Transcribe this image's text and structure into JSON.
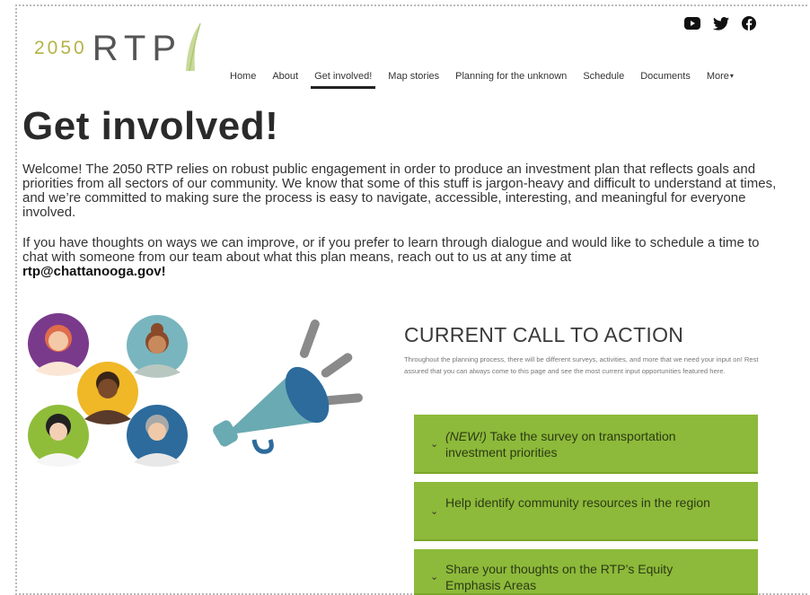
{
  "header": {
    "logo_year": "2050",
    "logo_name": "RTP",
    "social": [
      {
        "icon": "youtube-icon"
      },
      {
        "icon": "twitter-icon"
      },
      {
        "icon": "facebook-icon"
      }
    ]
  },
  "nav": {
    "items": [
      {
        "label": "Home"
      },
      {
        "label": "About"
      },
      {
        "label": "Get involved!"
      },
      {
        "label": "Map stories"
      },
      {
        "label": "Planning for the unknown"
      },
      {
        "label": "Schedule"
      },
      {
        "label": "Documents"
      },
      {
        "label": "More"
      }
    ],
    "active": "Get involved!"
  },
  "main": {
    "title": "Get involved!",
    "intro_p1": "Welcome! The 2050 RTP relies on robust public engagement in order to produce an investment plan that reflects goals and priorities from all sectors of our community. We know that some of this stuff is jargon-heavy and difficult to understand at times, and we’re committed to making sure the process is easy to navigate, accessible, interesting, and meaningful for everyone involved.",
    "intro_p2": "If you have thoughts on ways we can improve, or if you prefer to learn through dialogue and would like to schedule a time to chat with someone from our team about what this plan means, reach out to us at any time at",
    "email": "rtp@chattanooga.gov!"
  },
  "cta": {
    "title": "CURRENT CALL TO ACTION",
    "description": "Throughout the planning process, there will be different surveys, activities, and more that we need your input on! Rest assured that you can always come to this page and see the most current input opportunities featured here.",
    "items": [
      {
        "prefix": "(NEW!)",
        "label": " Take the survey on transportation investment priorities"
      },
      {
        "label": "Help identify community resources in the region"
      },
      {
        "label": "Share your thoughts on the RTP’s Equity Emphasis Areas"
      }
    ]
  },
  "colors": {
    "accent_green": "#8dba3a",
    "logo_yellow": "#b6b248",
    "megaphone_teal": "#6aaab3"
  }
}
